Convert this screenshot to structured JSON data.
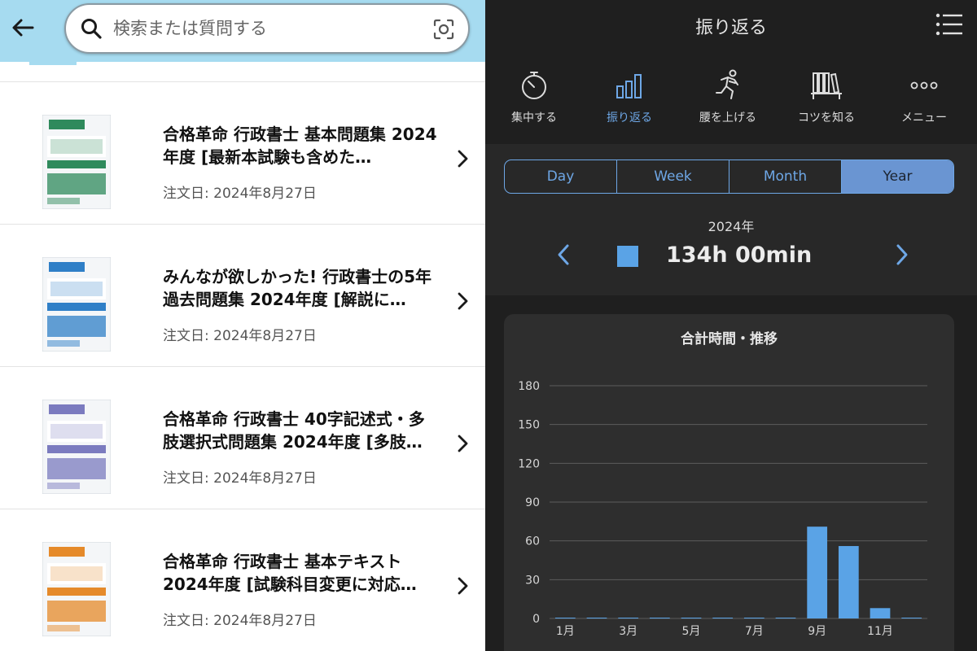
{
  "left_pane": {
    "search": {
      "placeholder": "検索または質問する"
    },
    "orders": [
      {
        "title": "合格革命 行政書士 基本問題集 2024年度 [最新本試験も含めた…",
        "date": "注文日: 2024年8月27日",
        "cover_color": "#2f8a5c"
      },
      {
        "title": "みんなが欲しかった! 行政書士の5年過去問題集 2024年度 [解説に…",
        "date": "注文日: 2024年8月27日",
        "cover_color": "#2f7fc7"
      },
      {
        "title": "合格革命 行政書士 40字記述式・多肢選択式問題集 2024年度 [多肢…",
        "date": "注文日: 2024年8月27日",
        "cover_color": "#7b7bbf"
      },
      {
        "title": "合格革命 行政書士 基本テキスト 2024年度 [試験科目変更に対応…",
        "date": "注文日: 2024年8月27日",
        "cover_color": "#e58a2a"
      }
    ]
  },
  "right_pane": {
    "header": {
      "title": "振り返る"
    },
    "nav": [
      {
        "label": "集中する",
        "icon": "stopwatch-icon",
        "active": false
      },
      {
        "label": "振り返る",
        "icon": "bar-chart-icon",
        "active": true
      },
      {
        "label": "腰を上げる",
        "icon": "running-icon",
        "active": false
      },
      {
        "label": "コツを知る",
        "icon": "bookshelf-icon",
        "active": false
      },
      {
        "label": "メニュー",
        "icon": "more-dots-icon",
        "active": false
      }
    ],
    "periods": [
      "Day",
      "Week",
      "Month",
      "Year"
    ],
    "selected_period": "Year",
    "year_label": "2024年",
    "total_time": "134h 00min",
    "accent_color": "#5aa3e6"
  },
  "chart_data": {
    "type": "bar",
    "title": "合計時間・推移",
    "categories": [
      "1月",
      "2月",
      "3月",
      "4月",
      "5月",
      "6月",
      "7月",
      "8月",
      "9月",
      "10月",
      "11月",
      "12月"
    ],
    "tick_labels_x": [
      "1月",
      "3月",
      "5月",
      "7月",
      "9月",
      "11月"
    ],
    "values": [
      0,
      0,
      0,
      0,
      0,
      0,
      0,
      0,
      71,
      56,
      8,
      0
    ],
    "ylim": [
      0,
      180
    ],
    "yticks": [
      0,
      30,
      60,
      90,
      120,
      150,
      180
    ],
    "grid": true,
    "bar_color": "#5aa3e6"
  }
}
